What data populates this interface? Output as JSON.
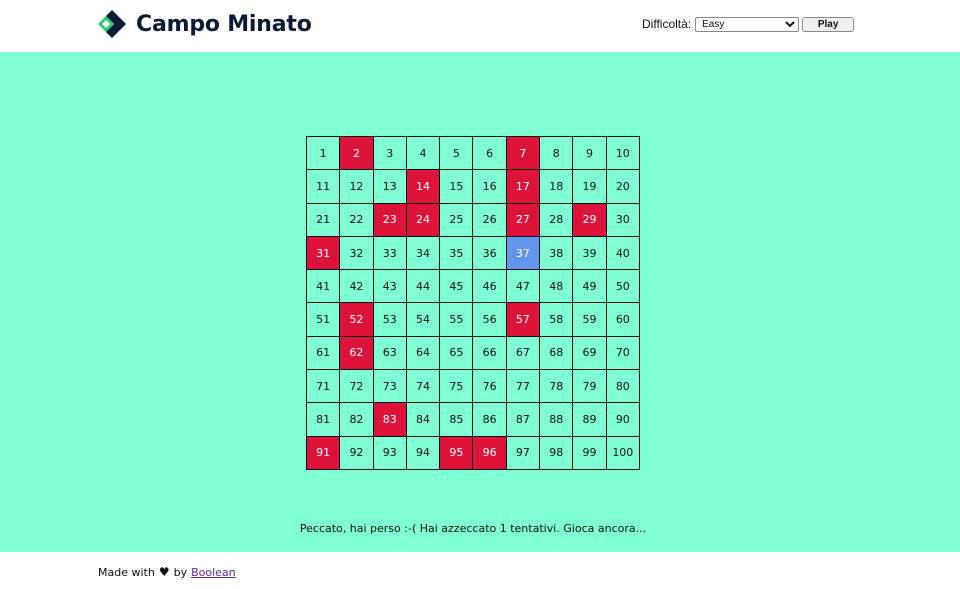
{
  "header": {
    "title": "Campo Minato",
    "logo_icon": "diamond-chevron-logo",
    "difficulty_label": "Difficoltà:",
    "difficulty_selected": "Easy",
    "play_button": "Play"
  },
  "board": {
    "cells": [
      "1",
      "2",
      "3",
      "4",
      "5",
      "6",
      "7",
      "8",
      "9",
      "10",
      "11",
      "12",
      "13",
      "14",
      "15",
      "16",
      "17",
      "18",
      "19",
      "20",
      "21",
      "22",
      "23",
      "24",
      "25",
      "26",
      "27",
      "28",
      "29",
      "30",
      "31",
      "32",
      "33",
      "34",
      "35",
      "36",
      "37",
      "38",
      "39",
      "40",
      "41",
      "42",
      "43",
      "44",
      "45",
      "46",
      "47",
      "48",
      "49",
      "50",
      "51",
      "52",
      "53",
      "54",
      "55",
      "56",
      "57",
      "58",
      "59",
      "60",
      "61",
      "62",
      "63",
      "64",
      "65",
      "66",
      "67",
      "68",
      "69",
      "70",
      "71",
      "72",
      "73",
      "74",
      "75",
      "76",
      "77",
      "78",
      "79",
      "80",
      "81",
      "82",
      "83",
      "84",
      "85",
      "86",
      "87",
      "88",
      "89",
      "90",
      "91",
      "92",
      "93",
      "94",
      "95",
      "96",
      "97",
      "98",
      "99",
      "100"
    ],
    "bombs": [
      2,
      7,
      14,
      17,
      23,
      24,
      27,
      29,
      31,
      52,
      57,
      62,
      83,
      91,
      95,
      96
    ],
    "clicked": [
      37
    ],
    "colors": {
      "background": "#80ffd5",
      "bomb": "#dc143c",
      "clicked": "#6495ed"
    }
  },
  "message": "Peccato, hai perso :-( Hai azzeccato 1 tentativi. Gioca ancora...",
  "footer": {
    "made_with": "Made with",
    "heart_icon": "heart-icon",
    "by": "by",
    "author_link": "Boolean"
  }
}
